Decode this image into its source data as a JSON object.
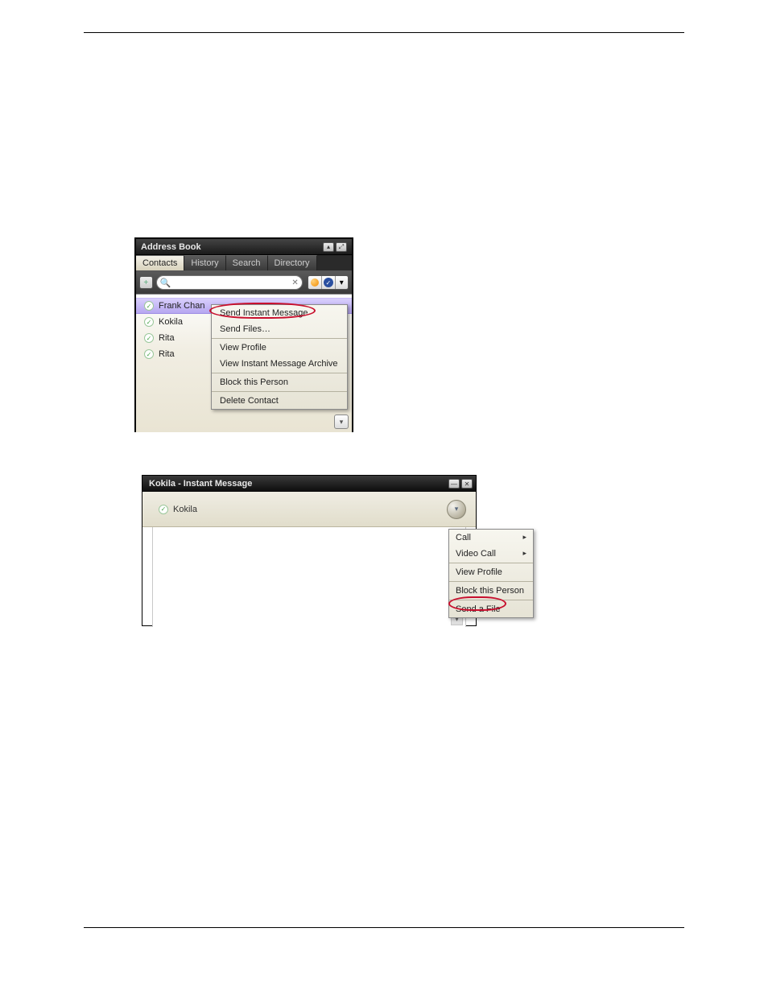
{
  "addressBook": {
    "title": "Address Book",
    "tabs": {
      "contacts": "Contacts",
      "history": "History",
      "search": "Search",
      "directory": "Directory"
    },
    "searchPlaceholder": "",
    "contacts": [
      {
        "name": "Frank Chan",
        "selected": true
      },
      {
        "name": "Kokila",
        "selected": false
      },
      {
        "name": "Rita",
        "selected": false
      },
      {
        "name": "Rita",
        "selected": false
      }
    ]
  },
  "contextMenu1": {
    "sendIM": "Send Instant Message",
    "sendFiles": "Send Files…",
    "viewProfile": "View Profile",
    "viewArchive": "View Instant Message Archive",
    "block": "Block this Person",
    "delete": "Delete Contact"
  },
  "imWindow": {
    "title": "Kokila - Instant Message",
    "contactName": "Kokila"
  },
  "contextMenu2": {
    "call": "Call",
    "videoCall": "Video Call",
    "viewProfile": "View Profile",
    "block": "Block this Person",
    "sendFile": "Send a File"
  }
}
